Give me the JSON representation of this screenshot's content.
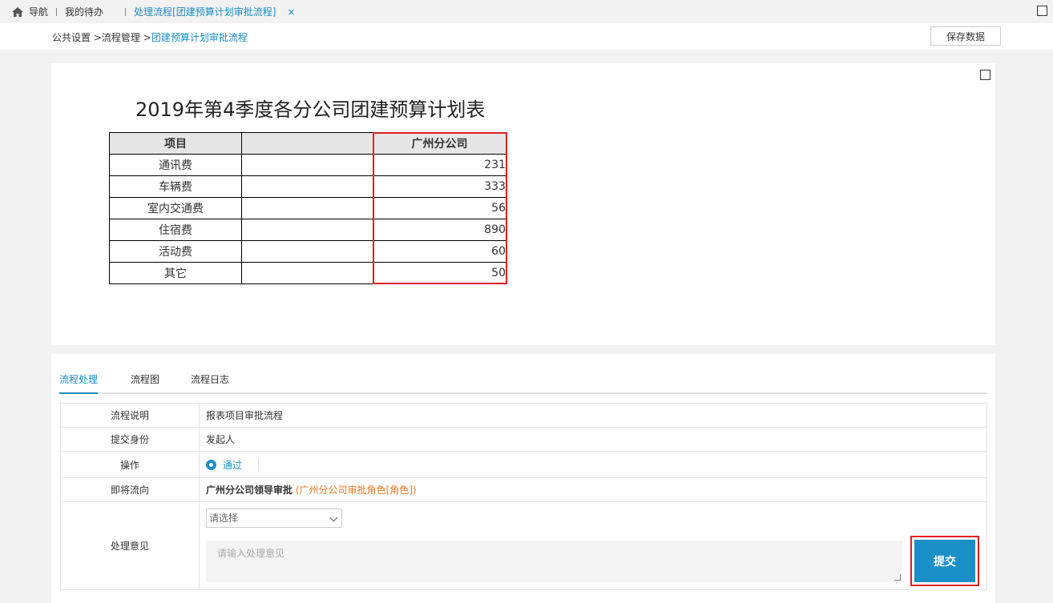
{
  "topbar": {
    "nav_label": "导航",
    "todo_label": "我的待办",
    "active_tab": "处理流程[团建预算计划审批流程]",
    "close_glyph": "×"
  },
  "breadcrumb": {
    "part1": "公共设置",
    "part2": "流程管理",
    "current": "团建预算计划审批流程",
    "sep": ">"
  },
  "actions": {
    "save_label": "保存数据"
  },
  "report": {
    "title": "2019年第4季度各分公司团建预算计划表",
    "headers": [
      "项目",
      "",
      "广州分公司"
    ],
    "rows": [
      {
        "item": "通讯费",
        "value": "231"
      },
      {
        "item": "车辆费",
        "value": "333"
      },
      {
        "item": "室内交通费",
        "value": "56"
      },
      {
        "item": "住宿费",
        "value": "890"
      },
      {
        "item": "活动费",
        "value": "60"
      },
      {
        "item": "其它",
        "value": "50"
      }
    ]
  },
  "tabs": [
    "流程处理",
    "流程图",
    "流程日志"
  ],
  "form": {
    "desc_label": "流程说明",
    "desc_value": "报表项目审批流程",
    "identity_label": "提交身份",
    "identity_value": "发起人",
    "op_label": "操作",
    "op_value": "通过",
    "dest_label": "即将流向",
    "dest_value": "广州分公司领导审批",
    "dest_role": "(广州分公司审批角色[角色])",
    "opinion_label": "处理意见",
    "select_placeholder": "请选择",
    "textarea_placeholder": "请输入处理意见",
    "submit_label": "提交"
  },
  "colors": {
    "accent": "#1a8fc7",
    "highlight": "#e02020",
    "role": "#e8781f"
  },
  "icons": [
    "home-icon",
    "close-icon",
    "maximize-icon",
    "chevron-down-icon",
    "radio-checked-icon"
  ]
}
